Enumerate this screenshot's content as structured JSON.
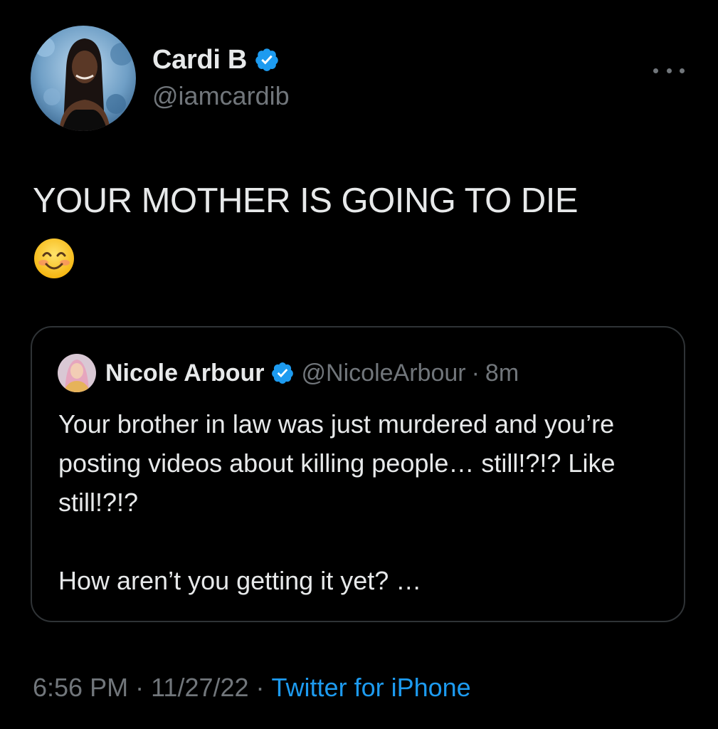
{
  "tweet": {
    "author": {
      "name": "Cardi B",
      "handle": "@iamcardib",
      "verified": true
    },
    "text": "YOUR MOTHER IS GOING TO DIE",
    "emoji": "smiling-face-with-smiling-eyes",
    "quoted": {
      "name": "Nicole Arbour",
      "handle": "@NicoleArbour",
      "separator": "·",
      "time": "8m",
      "paragraph1": "Your brother in law was just murdered and you’re posting videos about killing people… still!?!? Like still!?!?",
      "paragraph2": "How aren’t you getting it yet? …"
    },
    "footer": {
      "time": "6:56 PM",
      "sep1": "·",
      "date": "11/27/22",
      "sep2": "·",
      "source": "Twitter for iPhone"
    }
  },
  "colors": {
    "background": "#000000",
    "text": "#e7e9ea",
    "muted": "#71767b",
    "accent": "#1d9bf0",
    "border": "#2f3336"
  },
  "icons": [
    "verified-badge-icon",
    "more-options-icon",
    "smiling-face-emoji-icon"
  ]
}
